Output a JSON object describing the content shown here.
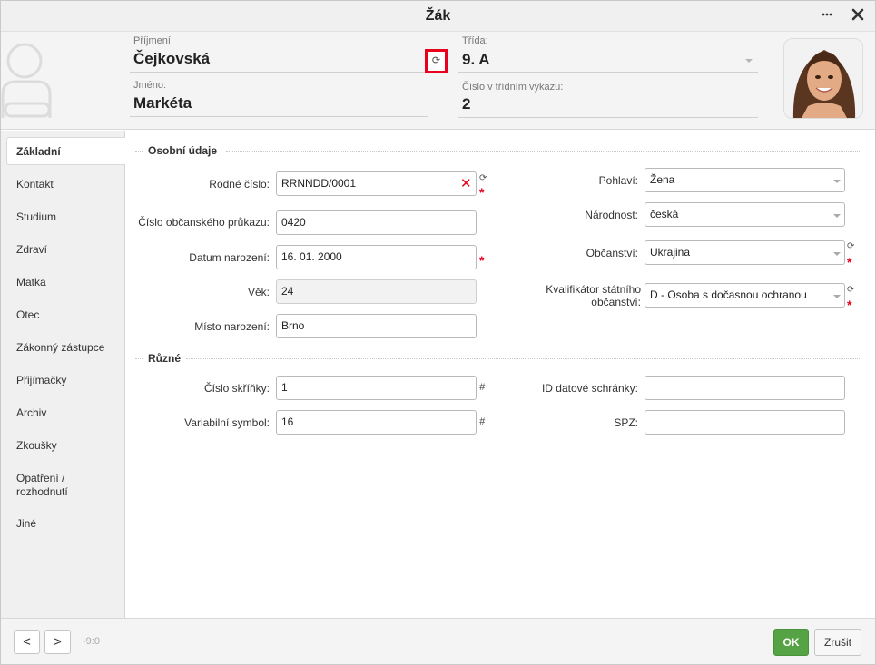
{
  "window": {
    "title": "Žák"
  },
  "header": {
    "surname_label": "Příjmení:",
    "surname_value": "Čejkovská",
    "firstname_label": "Jméno:",
    "firstname_value": "Markéta",
    "class_label": "Třída:",
    "class_value": "9. A",
    "classnum_label": "Číslo v třídním výkazu:",
    "classnum_value": "2"
  },
  "sidebar": {
    "items": [
      {
        "label": "Základní"
      },
      {
        "label": "Kontakt"
      },
      {
        "label": "Studium"
      },
      {
        "label": "Zdraví"
      },
      {
        "label": "Matka"
      },
      {
        "label": "Otec"
      },
      {
        "label": "Zákonný zástupce"
      },
      {
        "label": "Přijímačky"
      },
      {
        "label": "Archiv"
      },
      {
        "label": "Zkoušky"
      },
      {
        "label": "Opatření / rozhodnutí"
      },
      {
        "label": "Jiné"
      }
    ]
  },
  "personal": {
    "title": "Osobní údaje",
    "birth_number_label": "Rodné číslo:",
    "birth_number_value": "RRNNDD/0001",
    "id_card_label": "Číslo občanského průkazu:",
    "id_card_value": "0420",
    "birth_date_label": "Datum narození:",
    "birth_date_value": "16. 01. 2000",
    "age_label": "Věk:",
    "age_value": "24",
    "birth_place_label": "Místo narození:",
    "birth_place_value": "Brno",
    "gender_label": "Pohlaví:",
    "gender_value": "Žena",
    "nationality_label": "Národnost:",
    "nationality_value": "česká",
    "citizenship_label": "Občanství:",
    "citizenship_value": "Ukrajina",
    "qualifier_label": "Kvalifikátor státního občanství:",
    "qualifier_value": "D - Osoba s dočasnou ochranou"
  },
  "misc": {
    "title": "Různé",
    "locker_label": "Číslo skříňky:",
    "locker_value": "1",
    "varsym_label": "Variabilní symbol:",
    "varsym_value": "16",
    "databox_label": "ID datové schránky:",
    "databox_value": "",
    "spz_label": "SPZ:",
    "spz_value": ""
  },
  "footer": {
    "prev_label": "<",
    "next_label": ">",
    "counter": "-9:0",
    "ok_label": "OK",
    "cancel_label": "Zrušit"
  },
  "glyphs": {
    "required": "*",
    "hash": "#",
    "sync": "⟳",
    "clear": "✕",
    "dots": "•••",
    "close": "✖"
  },
  "colors": {
    "accent_ok": "#56a345",
    "required": "#e8001c",
    "highlight_box": "#e8001c"
  }
}
